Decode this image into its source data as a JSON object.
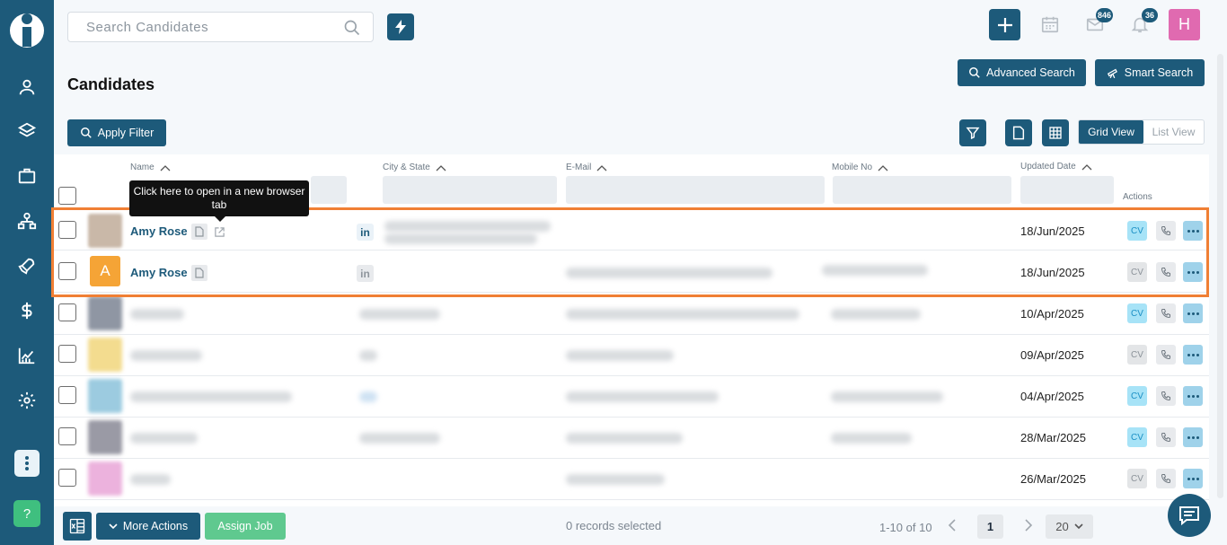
{
  "search": {
    "placeholder": "Search Candidates"
  },
  "topbar": {
    "mail_count": "846",
    "notification_count": "36",
    "avatar_initial": "H"
  },
  "page": {
    "title": "Candidates",
    "advanced_search": "Advanced Search",
    "smart_search": "Smart Search",
    "apply_filter": "Apply Filter",
    "grid_view": "Grid View",
    "list_view": "List View"
  },
  "table": {
    "columns": {
      "name": "Name",
      "city_state": "City & State",
      "email": "E-Mail",
      "mobile": "Mobile No",
      "updated": "Updated Date",
      "actions": "Actions"
    },
    "tooltip": "Click here to open in a new browser tab",
    "rows": [
      {
        "name": "Amy Rose",
        "date": "18/Jun/2025",
        "cv": "CV",
        "avatar_letter": "",
        "avatar_color": "#c9b8a8"
      },
      {
        "name": "Amy Rose",
        "date": "18/Jun/2025",
        "cv": "CV",
        "avatar_letter": "A",
        "avatar_color": "#f5a436"
      },
      {
        "name": "",
        "date": "10/Apr/2025",
        "cv": "CV",
        "avatar_color": "#8f96a3"
      },
      {
        "name": "",
        "date": "09/Apr/2025",
        "cv": "CV",
        "avatar_color": "#f3dc8f"
      },
      {
        "name": "",
        "date": "04/Apr/2025",
        "cv": "CV",
        "avatar_color": "#9ccbe0"
      },
      {
        "name": "",
        "date": "28/Mar/2025",
        "cv": "CV",
        "avatar_color": "#9a9aa5"
      },
      {
        "name": "",
        "date": "26/Mar/2025",
        "cv": "CV",
        "avatar_color": "#ecb2dd"
      }
    ]
  },
  "footer": {
    "more_actions": "More Actions",
    "assign_job": "Assign Job",
    "selected": "0 records selected",
    "range": "1-10 of 10",
    "page": "1",
    "page_size": "20"
  },
  "sidebar": {
    "help": "?"
  }
}
